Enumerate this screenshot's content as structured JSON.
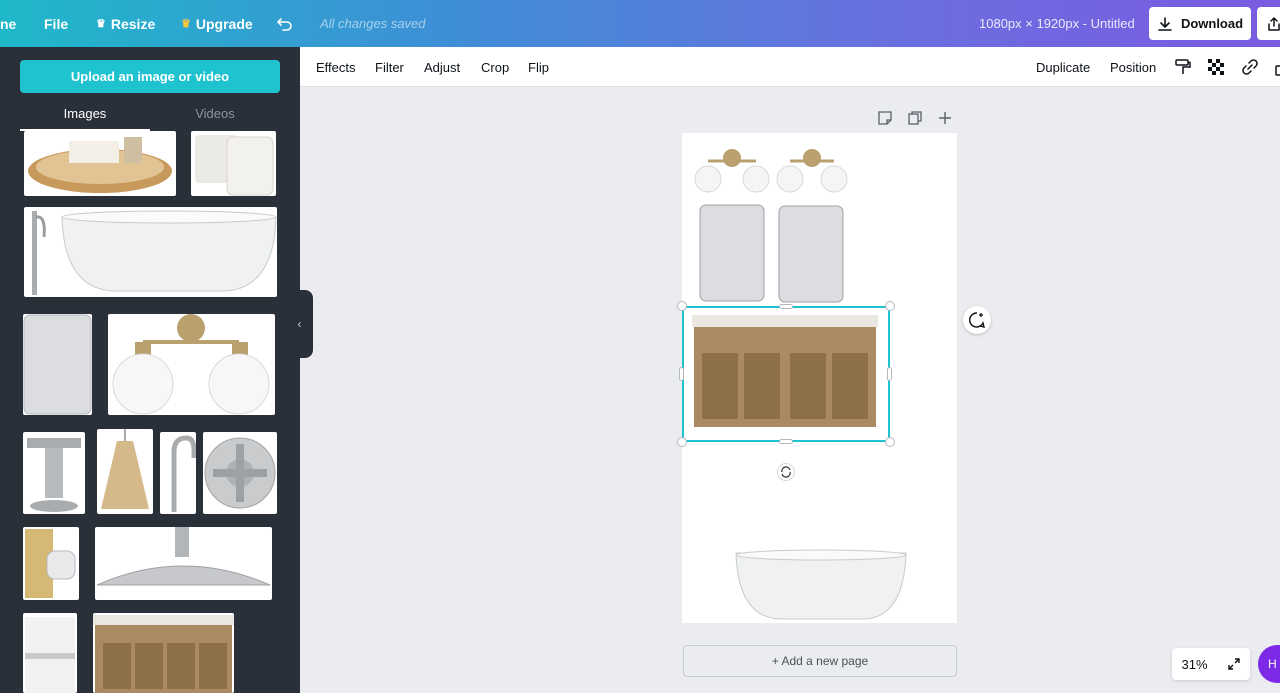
{
  "topbar": {
    "home_fragment": "ne",
    "file": "File",
    "resize": "Resize",
    "upgrade": "Upgrade",
    "saved_status": "All changes saved",
    "doc_info": "1080px × 1920px - Untitled",
    "download": "Download"
  },
  "sidebar": {
    "upload_label": "Upload an image or video",
    "tabs": [
      {
        "label": "Images",
        "active": true
      },
      {
        "label": "Videos",
        "active": false
      }
    ]
  },
  "toolbar": {
    "effects": "Effects",
    "filter": "Filter",
    "adjust": "Adjust",
    "crop": "Crop",
    "flip": "Flip",
    "duplicate": "Duplicate",
    "position": "Position"
  },
  "canvas": {
    "add_page": "+ Add a new page",
    "zoom": "31%",
    "help_fragment": "H"
  },
  "colors": {
    "accent": "#1fc3cf",
    "sidebar_bg": "#293039",
    "brass": "#b9a06e",
    "wood": "#a98a63"
  }
}
